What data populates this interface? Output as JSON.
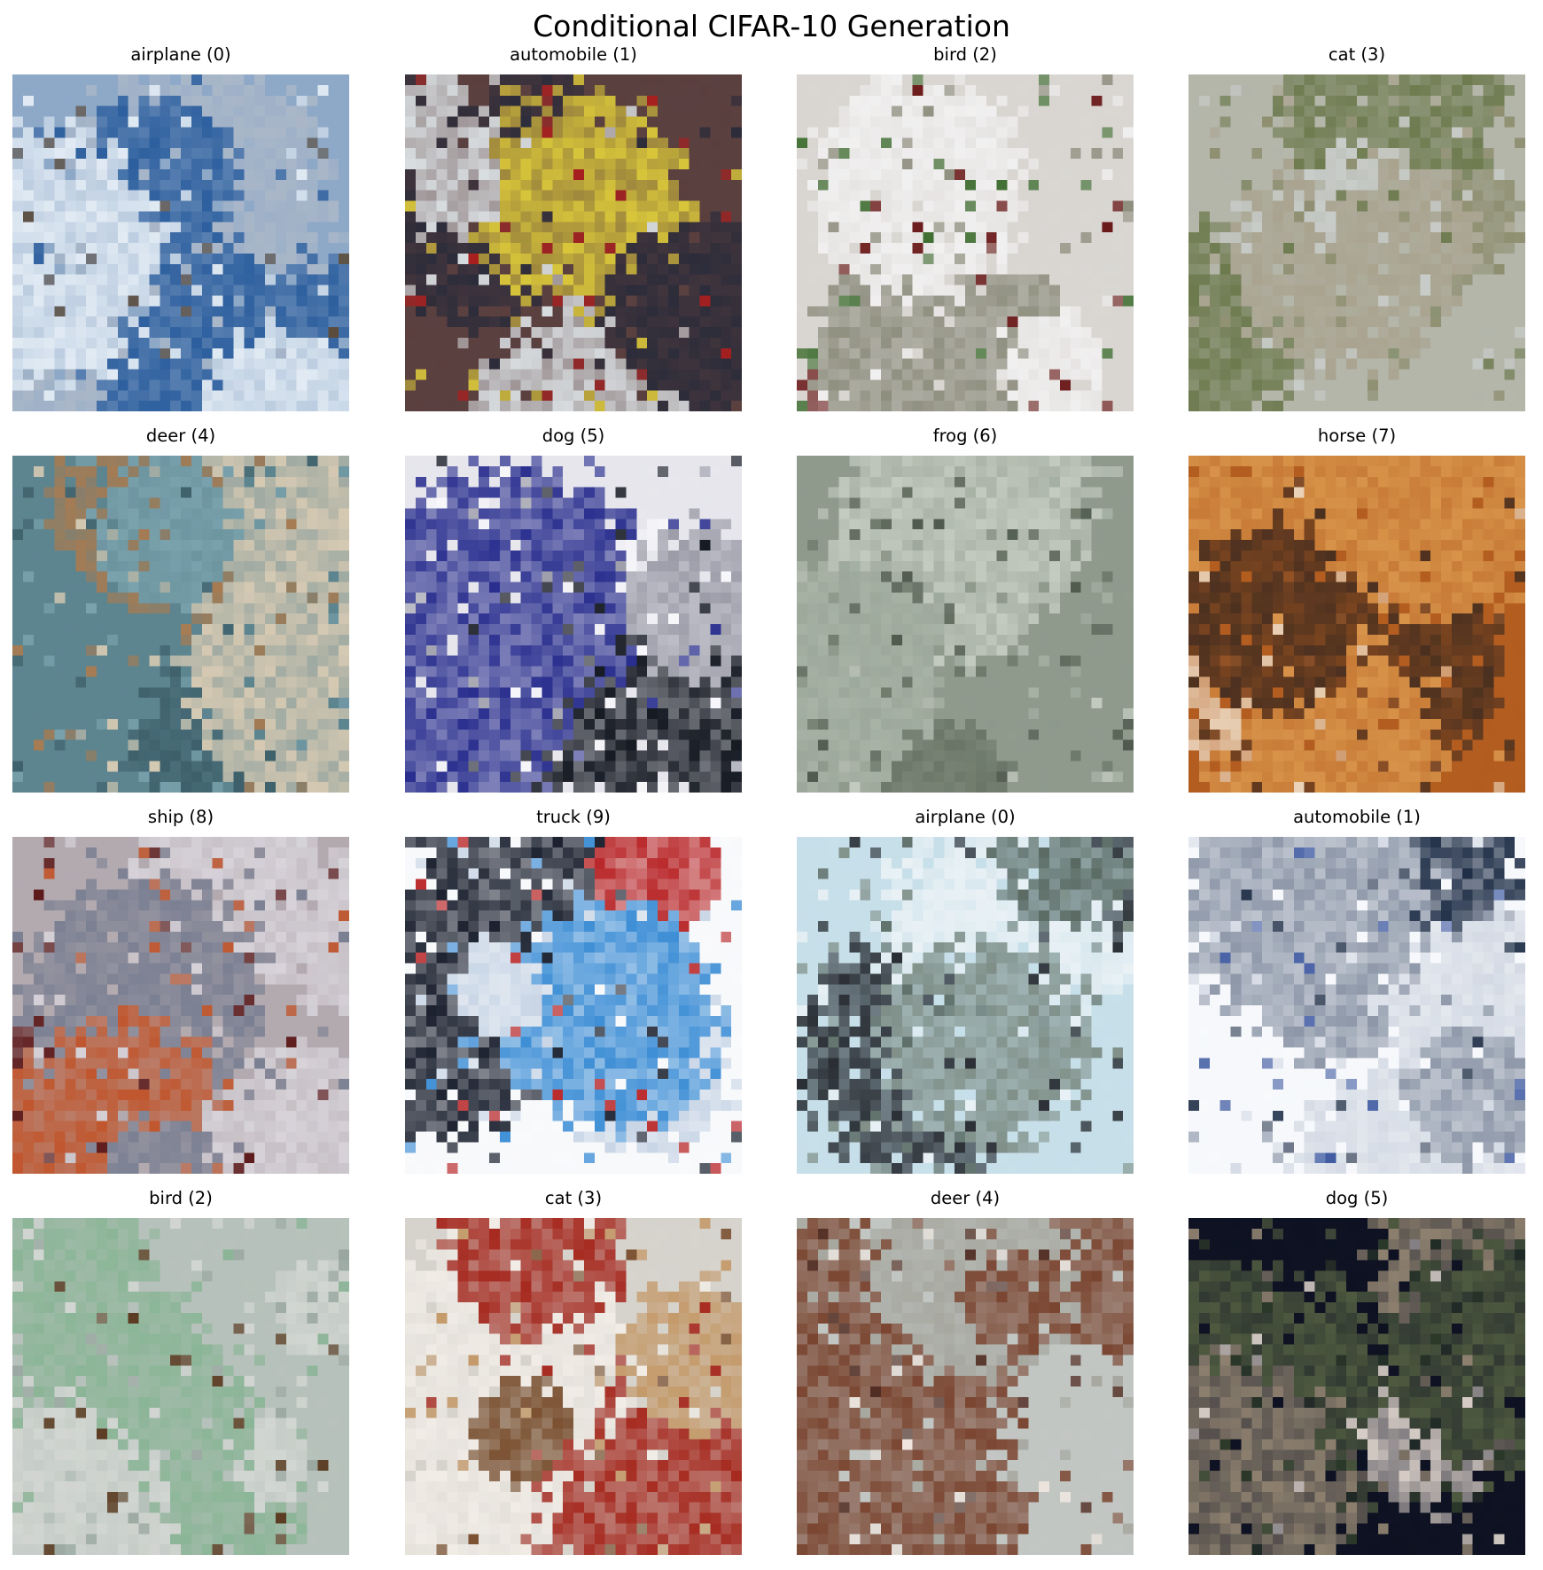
{
  "figure": {
    "title": "Conditional CIFAR-10 Generation"
  },
  "samples": [
    {
      "label": "airplane (0)",
      "colors": {
        "bg": "#8ea8c8",
        "a": "#2d5f9e",
        "b": "#e2ebf4",
        "c": "#5a4a3a",
        "d": "#aab7c8"
      }
    },
    {
      "label": "automobile (1)",
      "colors": {
        "bg": "#5b4040",
        "a": "#a81f1f",
        "b": "#d8dde0",
        "c": "#2c2c3a",
        "d": "#d8c53a"
      }
    },
    {
      "label": "bird (2)",
      "colors": {
        "bg": "#d9d6d2",
        "a": "#f1f0f0",
        "b": "#6b1a1a",
        "c": "#3d6d2f",
        "d": "#8f8f80"
      }
    },
    {
      "label": "cat (3)",
      "colors": {
        "bg": "#b4b6aa",
        "a": "#c9cdca",
        "b": "#8e8e70",
        "c": "#6d7a4e",
        "d": "#a9a38f"
      }
    },
    {
      "label": "deer (4)",
      "colors": {
        "bg": "#5d8590",
        "a": "#7aa2ad",
        "b": "#3d5f6a",
        "c": "#a67b52",
        "d": "#d6c9b2"
      }
    },
    {
      "label": "dog (5)",
      "colors": {
        "bg": "#e6e6ec",
        "a": "#141821",
        "b": "#f7f7fb",
        "c": "#2a2f8f",
        "d": "#9b9ba8"
      }
    },
    {
      "label": "frog (6)",
      "colors": {
        "bg": "#8f9a8d",
        "a": "#a8b3a6",
        "b": "#6a7567",
        "c": "#c3cac0",
        "d": "#4e584c"
      }
    },
    {
      "label": "horse (7)",
      "colors": {
        "bg": "#b35d20",
        "a": "#d8944a",
        "b": "#4a3020",
        "c": "#e9d2b8",
        "d": "#7a4a2a"
      }
    },
    {
      "label": "ship (8)",
      "colors": {
        "bg": "#b3aab0",
        "a": "#d7d3d9",
        "b": "#5d1a1a",
        "c": "#c0562d",
        "d": "#7a7f92"
      }
    },
    {
      "label": "truck (9)",
      "colors": {
        "bg": "#f8f9fb",
        "a": "#3f8fd6",
        "b": "#1c2230",
        "c": "#b9282a",
        "d": "#c9d6e6"
      }
    },
    {
      "label": "airplane (0)",
      "colors": {
        "bg": "#c7dfe9",
        "a": "#e9f1f5",
        "b": "#5a6a63",
        "c": "#7f8f88",
        "d": "#2a2f35"
      }
    },
    {
      "label": "automobile (1)",
      "colors": {
        "bg": "#f6f8fb",
        "a": "#1d2c45",
        "b": "#3c57a0",
        "c": "#8d97a8",
        "d": "#d4dae4"
      }
    },
    {
      "label": "bird (2)",
      "colors": {
        "bg": "#b7c1bb",
        "a": "#8bb597",
        "b": "#d2d6d2",
        "c": "#5a3a20",
        "d": "#9aa7a1"
      }
    },
    {
      "label": "cat (3)",
      "colors": {
        "bg": "#d6d3cd",
        "a": "#a62a20",
        "b": "#7a5030",
        "c": "#f1ece6",
        "d": "#c49a6a"
      }
    },
    {
      "label": "deer (4)",
      "colors": {
        "bg": "#c2c6c3",
        "a": "#7a4530",
        "b": "#f0e6df",
        "c": "#502a20",
        "d": "#a6a79f"
      }
    },
    {
      "label": "dog (5)",
      "colors": {
        "bg": "#0e1222",
        "a": "#d9cfc8",
        "b": "#2d3a2a",
        "c": "#8f8270",
        "d": "#4f5b40"
      }
    }
  ]
}
